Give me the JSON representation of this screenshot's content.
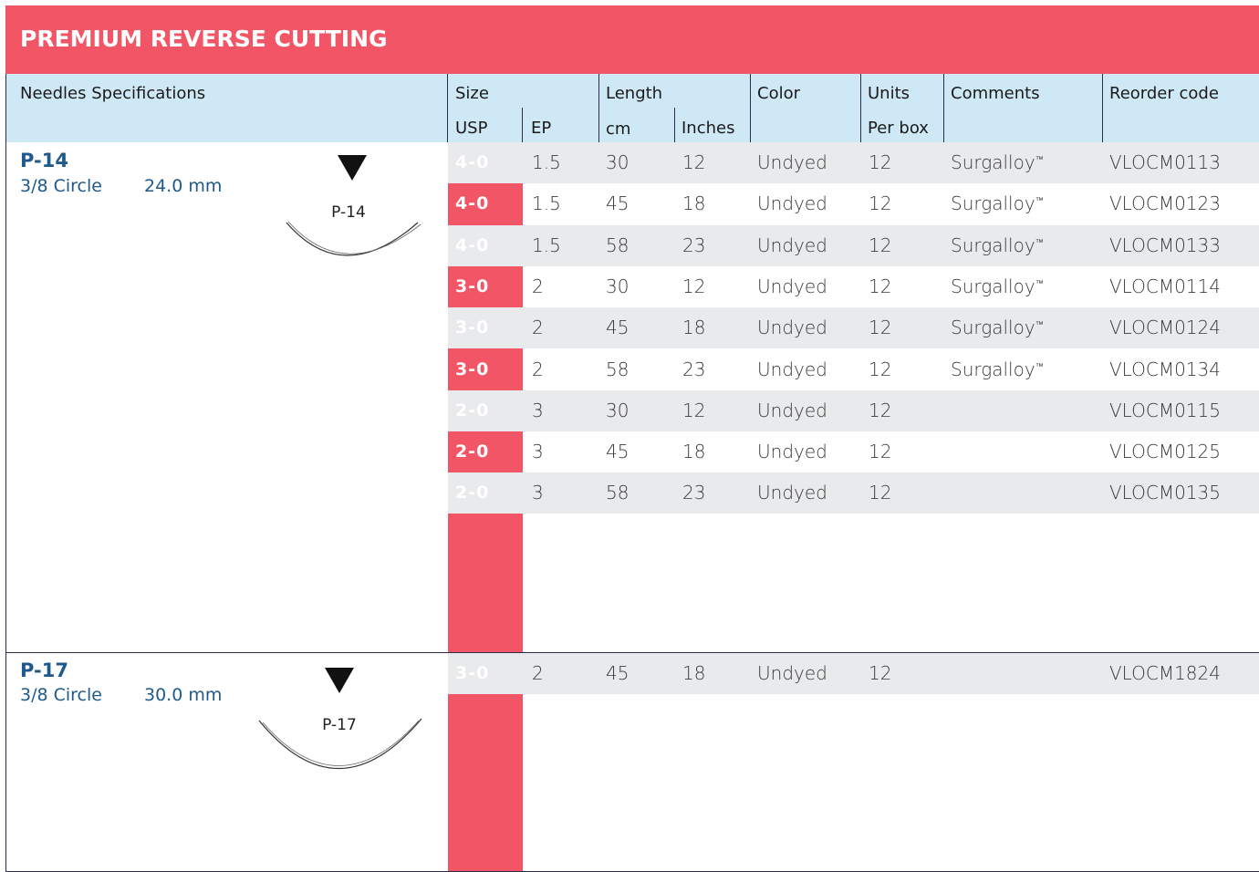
{
  "title": "PREMIUM REVERSE CUTTING",
  "headers": {
    "needles_spec": "Needles Specifications",
    "size": "Size",
    "usp": "USP",
    "ep": "EP",
    "length": "Length",
    "cm": "cm",
    "inches": "Inches",
    "color": "Color",
    "units": "Units",
    "per_box": "Per box",
    "comments": "Comments",
    "reorder": "Reorder code"
  },
  "needles": [
    {
      "name": "P-14",
      "shape": "3/8 Circle",
      "length": "24.0 mm",
      "label": "P-14",
      "rows": [
        {
          "usp": "4-0",
          "ep": "1.5",
          "cm": "30",
          "inches": "12",
          "color": "Undyed",
          "units": "12",
          "comment": "Surgalloy",
          "code": "VLOCM0113"
        },
        {
          "usp": "4-0",
          "ep": "1.5",
          "cm": "45",
          "inches": "18",
          "color": "Undyed",
          "units": "12",
          "comment": "Surgalloy",
          "code": "VLOCM0123"
        },
        {
          "usp": "4-0",
          "ep": "1.5",
          "cm": "58",
          "inches": "23",
          "color": "Undyed",
          "units": "12",
          "comment": "Surgalloy",
          "code": "VLOCM0133"
        },
        {
          "usp": "3-0",
          "ep": "2",
          "cm": "30",
          "inches": "12",
          "color": "Undyed",
          "units": "12",
          "comment": "Surgalloy",
          "code": "VLOCM0114"
        },
        {
          "usp": "3-0",
          "ep": "2",
          "cm": "45",
          "inches": "18",
          "color": "Undyed",
          "units": "12",
          "comment": "Surgalloy",
          "code": "VLOCM0124"
        },
        {
          "usp": "3-0",
          "ep": "2",
          "cm": "58",
          "inches": "23",
          "color": "Undyed",
          "units": "12",
          "comment": "Surgalloy",
          "code": "VLOCM0134"
        },
        {
          "usp": "2-0",
          "ep": "3",
          "cm": "30",
          "inches": "12",
          "color": "Undyed",
          "units": "12",
          "comment": "",
          "code": "VLOCM0115"
        },
        {
          "usp": "2-0",
          "ep": "3",
          "cm": "45",
          "inches": "18",
          "color": "Undyed",
          "units": "12",
          "comment": "",
          "code": "VLOCM0125"
        },
        {
          "usp": "2-0",
          "ep": "3",
          "cm": "58",
          "inches": "23",
          "color": "Undyed",
          "units": "12",
          "comment": "",
          "code": "VLOCM0135"
        }
      ]
    },
    {
      "name": "P-17",
      "shape": "3/8 Circle",
      "length": "30.0 mm",
      "label": "P-17",
      "rows": [
        {
          "usp": "3-0",
          "ep": "2",
          "cm": "45",
          "inches": "18",
          "color": "Undyed",
          "units": "12",
          "comment": "",
          "code": "VLOCM1824"
        }
      ]
    }
  ],
  "trademark": "™",
  "colors": {
    "accent": "#f25666",
    "header_bg": "#cfe8f5",
    "shade": "#e9eaec",
    "needle_text": "#1f5a8a"
  }
}
